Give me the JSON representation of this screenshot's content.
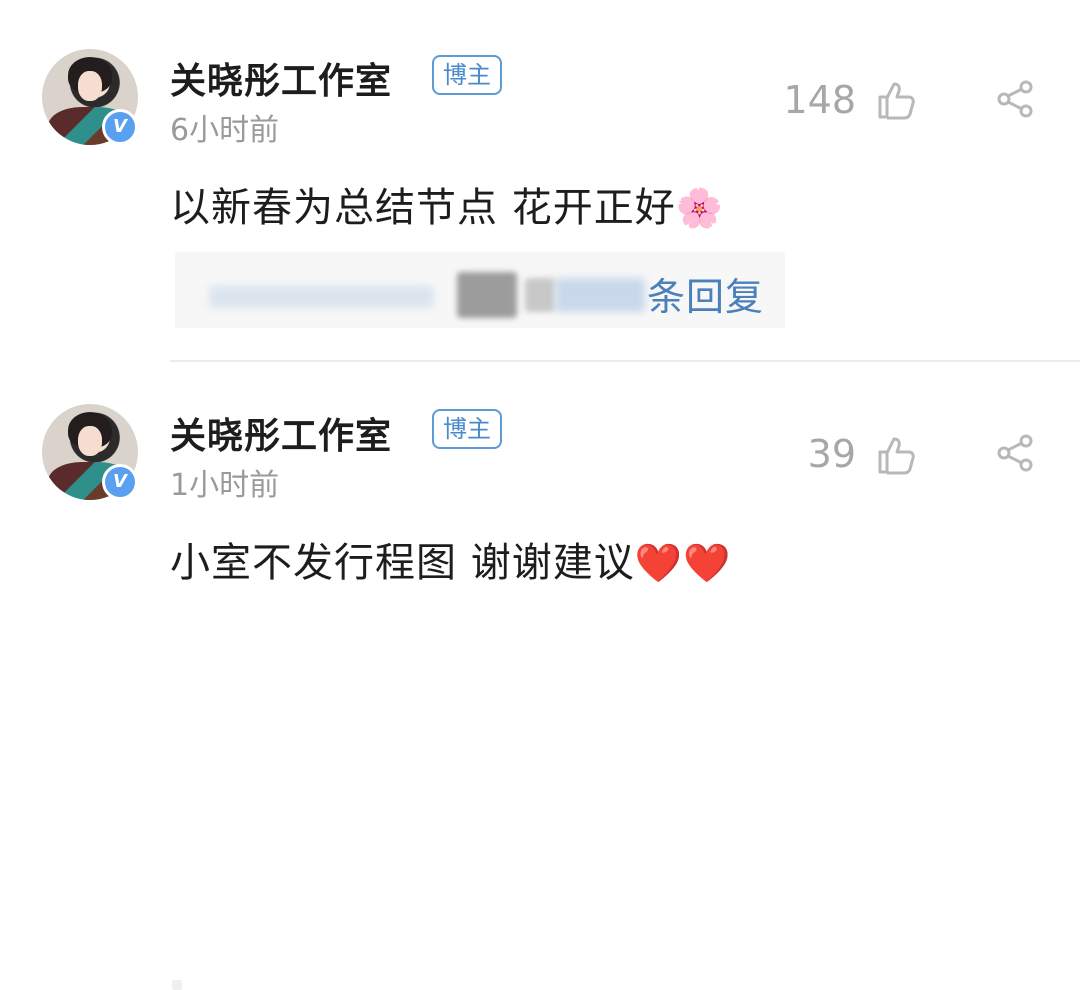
{
  "comments": [
    {
      "author": "关晓彤工作室",
      "badge": "博主",
      "time": "6小时前",
      "likes": "148",
      "content": "以新春为总结节点 花开正好",
      "emoji": "🌸",
      "reply_text": "条回复"
    },
    {
      "author": "关晓彤工作室",
      "badge": "博主",
      "time": "1小时前",
      "likes": "39",
      "content": "小室不发行程图 谢谢建议",
      "emoji": "❤️❤️"
    }
  ],
  "icons": {
    "verified": "V",
    "like": "thumbs-up-icon",
    "share": "share-icon"
  },
  "colors": {
    "badge": "#4a8acb",
    "reply_link": "#4b80b8",
    "verified": "#5aa0f0",
    "muted": "#9a9a9a"
  }
}
